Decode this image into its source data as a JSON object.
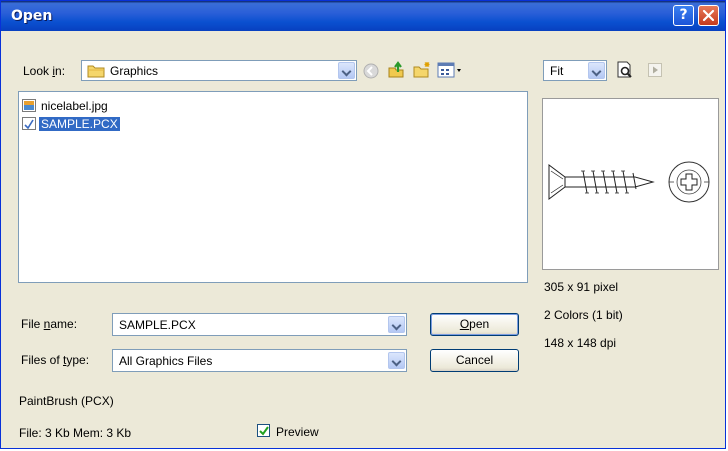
{
  "window": {
    "title": "Open",
    "help_glyph": "?"
  },
  "look_in": {
    "label": "Look in:",
    "value": "Graphics",
    "toolbar_icons": [
      "back-icon",
      "up-folder-icon",
      "new-folder-icon",
      "views-menu-icon"
    ]
  },
  "files": [
    {
      "name": "nicelabel.jpg",
      "icon": "jpg-file-icon",
      "selected": false
    },
    {
      "name": "SAMPLE.PCX",
      "icon": "pcx-file-icon",
      "selected": true
    }
  ],
  "preview_panel": {
    "zoom_value": "Fit",
    "info": [
      "305 x 91 pixel",
      "2 Colors (1 bit)",
      "148 x 148 dpi"
    ]
  },
  "file_name": {
    "label": "File name:",
    "value": "SAMPLE.PCX"
  },
  "file_type": {
    "label": "Files of type:",
    "value": "All Graphics Files"
  },
  "buttons": {
    "open": "Open",
    "cancel": "Cancel"
  },
  "format_info": "PaintBrush (PCX)",
  "size_info": "File: 3 Kb  Mem: 3 Kb",
  "preview_checkbox": {
    "label": "Preview",
    "checked": true
  },
  "colors": {
    "title_bar": "#0a50d0",
    "selection": "#316ac5",
    "dialog_bg": "#ece9d8"
  }
}
